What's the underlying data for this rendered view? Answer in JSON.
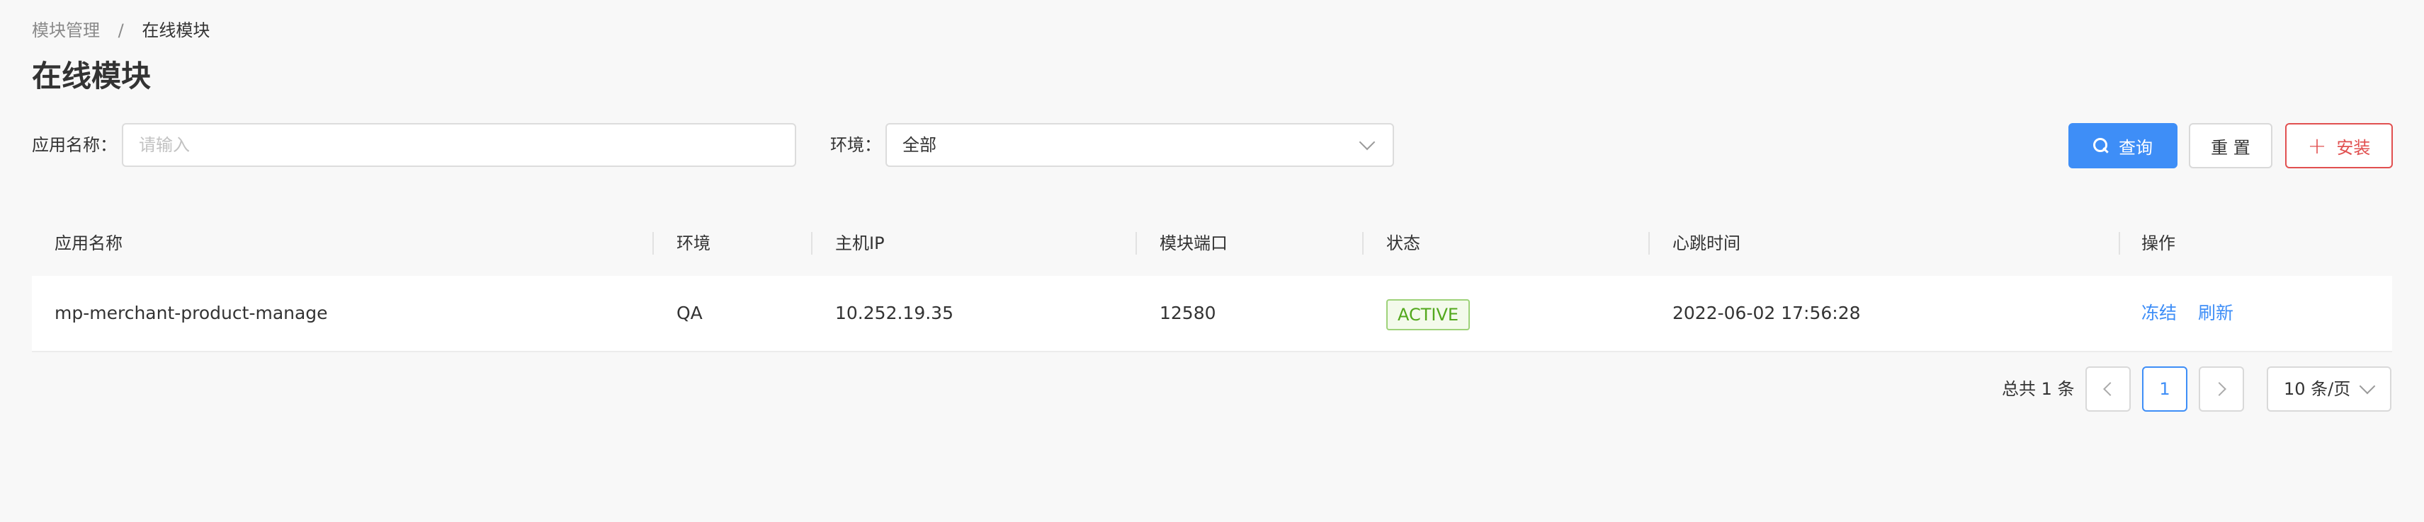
{
  "breadcrumb": {
    "parent": "模块管理",
    "separator": "/",
    "current": "在线模块"
  },
  "page_title": "在线模块",
  "filters": {
    "app_name_label": "应用名称：",
    "app_name_placeholder": "请输入",
    "app_name_value": "",
    "env_label": "环境：",
    "env_selected": "全部"
  },
  "buttons": {
    "search": "查询",
    "reset": "重 置",
    "install": "安装"
  },
  "icons": {
    "search": "search-icon",
    "plus": "plus-icon",
    "select_arrow": "chevron-down-icon",
    "prev": "chevron-left-icon",
    "next": "chevron-right-icon"
  },
  "table": {
    "columns": [
      "应用名称",
      "环境",
      "主机IP",
      "模块端口",
      "状态",
      "心跳时间",
      "操作"
    ],
    "rows": [
      {
        "app_name": "mp-merchant-product-manage",
        "env": "QA",
        "host_ip": "10.252.19.35",
        "port": "12580",
        "status": "ACTIVE",
        "heartbeat": "2022-06-02 17:56:28",
        "actions": [
          "冻结",
          "刷新"
        ]
      }
    ]
  },
  "pagination": {
    "total_text": "总共 1 条",
    "current_page": "1",
    "page_size": "10 条/页"
  },
  "colors": {
    "primary": "#3e8ef7",
    "danger": "#e15050",
    "status_active": "#52a81c",
    "background": "#f8f8f8"
  }
}
